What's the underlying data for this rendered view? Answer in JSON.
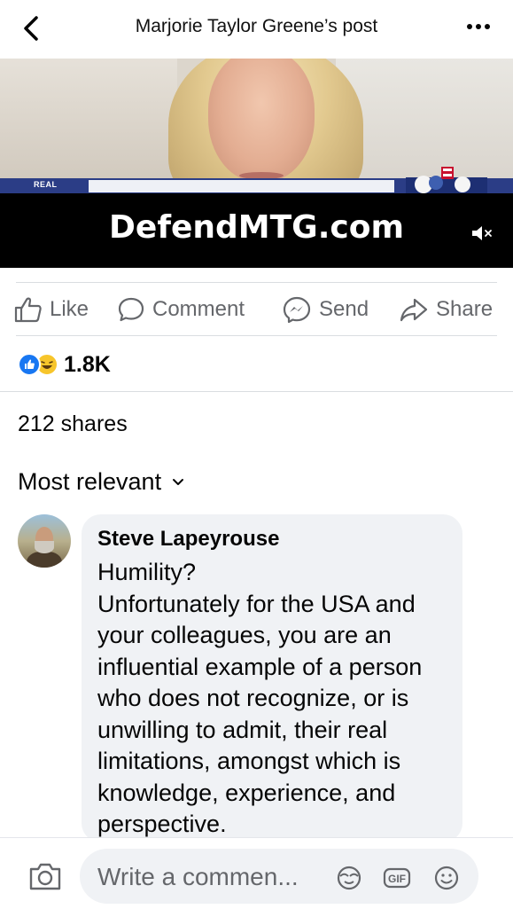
{
  "header": {
    "title": "Marjorie Taylor Greene’s post"
  },
  "video": {
    "overlay_text": "DefendMTG.com",
    "channel_logo": "REAL"
  },
  "actions": {
    "like": "Like",
    "comment": "Comment",
    "send": "Send",
    "share": "Share"
  },
  "reactions": {
    "count": "1.8K"
  },
  "shares": "212 shares",
  "sort": {
    "label": "Most relevant"
  },
  "comment": {
    "author": "Steve Lapeyrouse",
    "text": "Humility?\nUnfortunately for the USA and your colleagues, you are an influential example of a person who does not recognize, or is unwilling to admit, their real limitations, amongst which is knowledge, experience, and perspective."
  },
  "composer": {
    "placeholder": "Write a commen..."
  },
  "colors": {
    "accent": "#1877f2",
    "secondary_text": "#65676b",
    "bubble": "#f0f2f5",
    "haha": "#f7c52b"
  }
}
